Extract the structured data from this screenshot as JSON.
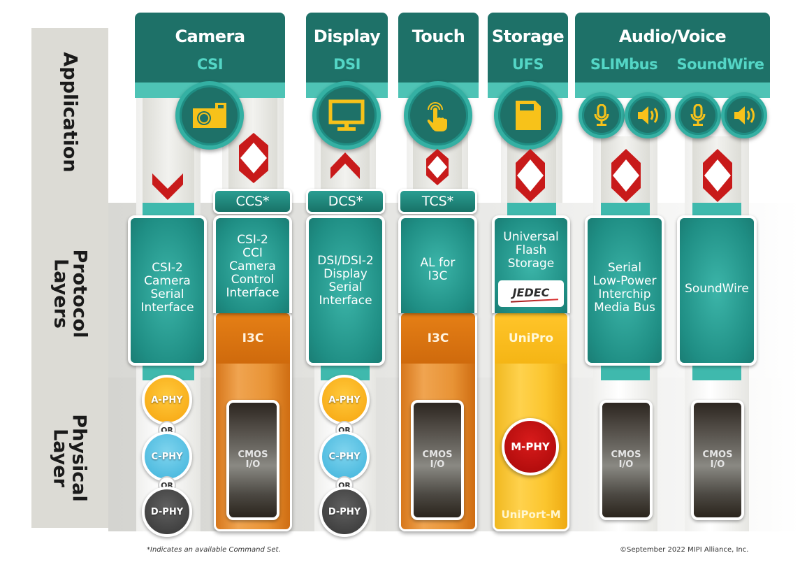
{
  "layers": {
    "application": "Application",
    "protocol": "Protocol\nLayers",
    "physical": "Physical\nLayer"
  },
  "applications": [
    {
      "title": "Camera",
      "subtitle": "CSI",
      "icon": "camera-icon"
    },
    {
      "title": "Display",
      "subtitle": "DSI",
      "icon": "monitor-icon"
    },
    {
      "title": "Touch",
      "subtitle": "",
      "icon": "touch-icon"
    },
    {
      "title": "Storage",
      "subtitle": "UFS",
      "icon": "sd-card-icon"
    },
    {
      "title": "Audio/Voice",
      "subtitles": [
        "SLIMbus",
        "SoundWire"
      ],
      "icons": [
        "microphone-icon",
        "speaker-icon",
        "microphone-icon",
        "speaker-icon"
      ]
    }
  ],
  "command_sets": [
    "CCS*",
    "DCS*",
    "TCS*"
  ],
  "protocols": [
    {
      "label": "CSI-2\nCamera\nSerial\nInterface"
    },
    {
      "label": "CSI-2\nCCI\nCamera\nControl\nInterface",
      "transport": "I3C"
    },
    {
      "label": "DSI/DSI-2\nDisplay\nSerial\nInterface"
    },
    {
      "label": "AL for\nI3C",
      "transport": "I3C"
    },
    {
      "label": "Universal\nFlash\nStorage",
      "logo": "JEDEC",
      "transport": "UniPro"
    },
    {
      "label": "Serial\nLow-Power\nInterchip\nMedia Bus"
    },
    {
      "label": "SoundWire"
    }
  ],
  "physical": {
    "phy_options": [
      "A-PHY",
      "C-PHY",
      "D-PHY"
    ],
    "or_label": "OR",
    "cmos": "CMOS\nI/O",
    "mphy": "M-PHY",
    "uniport": "UniPort-M"
  },
  "footnotes": {
    "left": "*Indicates an available Command Set.",
    "right": "©September 2022 MIPI Alliance, Inc."
  },
  "colors": {
    "header_teal": "#1e7168",
    "accent_teal": "#4ec3b5",
    "i3c_orange": "#e57f16",
    "unipro_yellow": "#ffc52a",
    "mphy_red": "#c40f0f",
    "arrow_red": "#c81a1a"
  }
}
